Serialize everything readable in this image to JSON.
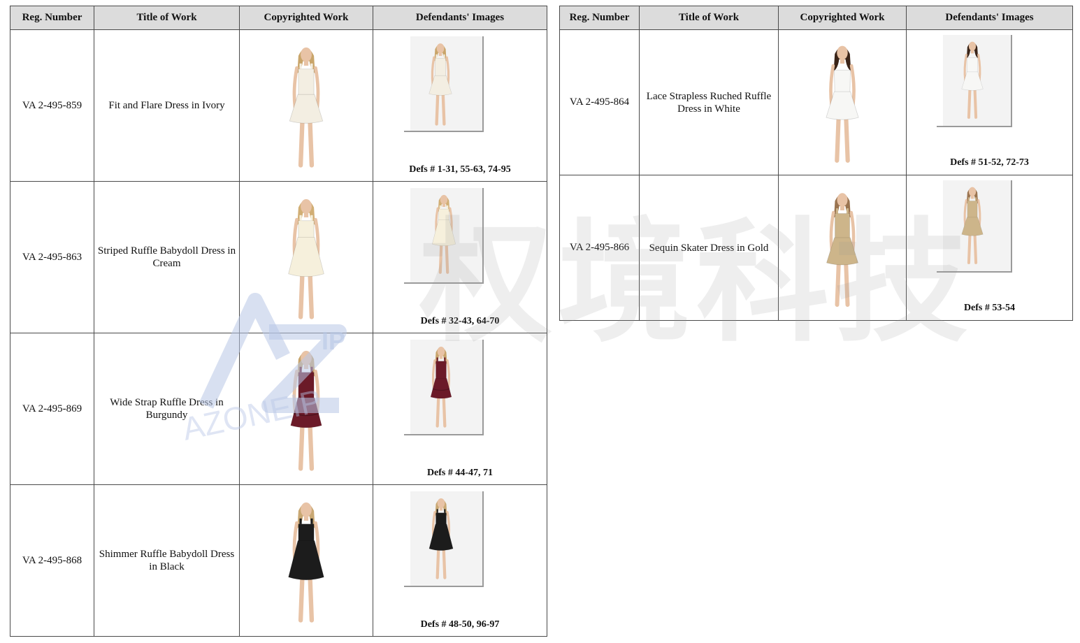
{
  "headers": {
    "reg_number": "Reg. Number",
    "title_of_work": "Title of Work",
    "copyrighted_work": "Copyrighted Work",
    "defendants_images": "Defendants' Images"
  },
  "left_rows": [
    {
      "reg": "VA 2-495-859",
      "title": "Fit and Flare Dress in Ivory",
      "defs": "Defs # 1-31, 55-63, 74-95",
      "dress_color": "#f3eee2",
      "hair_color": "#c9a56a",
      "style": "flare"
    },
    {
      "reg": "VA 2-495-863",
      "title": "Striped Ruffle Babydoll Dress in Cream",
      "defs": "Defs # 32-43, 64-70",
      "dress_color": "#f6f0dc",
      "hair_color": "#d1ae74",
      "style": "babydoll"
    },
    {
      "reg": "VA 2-495-869",
      "title": "Wide Strap Ruffle Dress in Burgundy",
      "defs": "Defs # 44-47, 71",
      "dress_color": "#6b1a28",
      "hair_color": "#c7a46c",
      "style": "tiered"
    },
    {
      "reg": "VA 2-495-868",
      "title": "Shimmer Ruffle Babydoll Dress in Black",
      "defs": "Defs # 48-50, 96-97",
      "dress_color": "#1c1c1c",
      "hair_color": "#c9a873",
      "style": "babydoll"
    }
  ],
  "right_rows": [
    {
      "reg": "VA 2-495-864",
      "title": "Lace Strapless Ruched Ruffle Dress in White",
      "defs": "Defs # 51-52, 72-73",
      "dress_color": "#f7f7f5",
      "hair_color": "#3a2418",
      "style": "strapless"
    },
    {
      "reg": "VA 2-495-866",
      "title": "Sequin Skater Dress in Gold",
      "defs": "Defs # 53-54",
      "dress_color": "#cdb58a",
      "hair_color": "#9a7450",
      "style": "flare"
    }
  ],
  "watermark": {
    "chinese_text": "权境科技",
    "logo_text": "AZONEIP",
    "logo_sub": "IP",
    "color": "#b8c6e6"
  }
}
